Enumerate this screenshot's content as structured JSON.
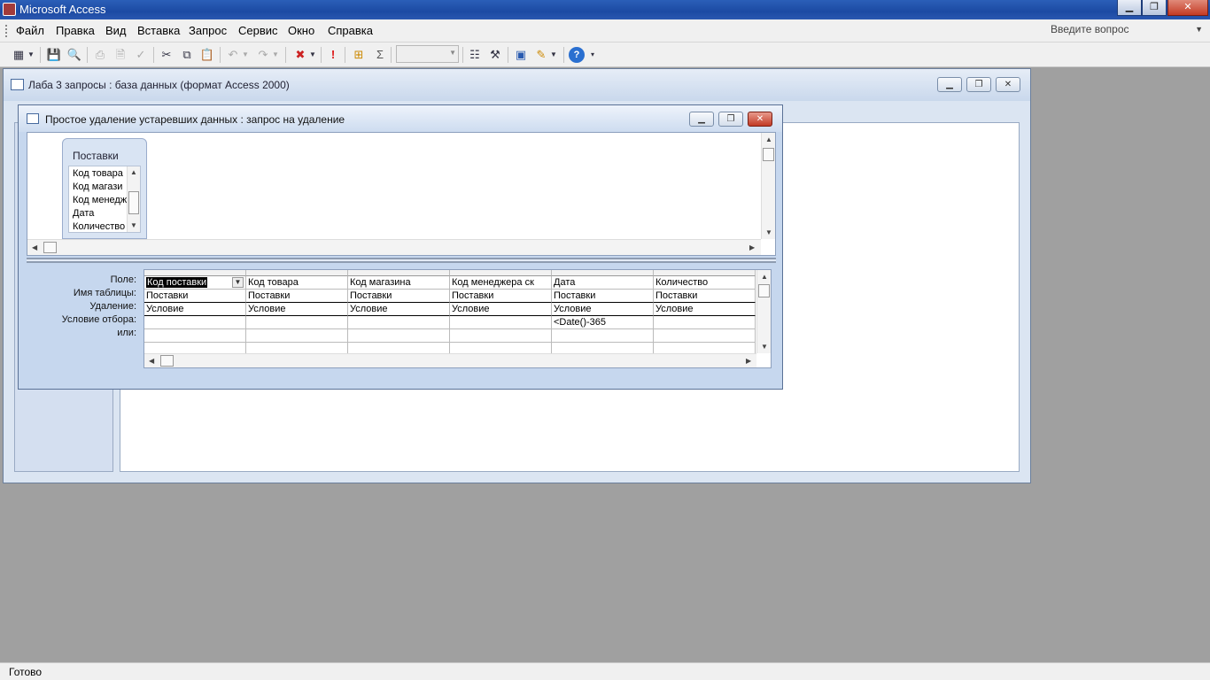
{
  "app": {
    "title": "Microsoft Access"
  },
  "menu": {
    "items": [
      "Файл",
      "Правка",
      "Вид",
      "Вставка",
      "Запрос",
      "Сервис",
      "Окно",
      "Справка"
    ],
    "help_placeholder": "Введите вопрос"
  },
  "toolbar": {
    "icons": [
      "view-icon",
      "save-icon",
      "search-icon",
      "print-icon",
      "preview-icon",
      "spell-icon",
      "cut-icon",
      "copy-icon",
      "paste-icon",
      "undo-icon",
      "redo-icon",
      "query-type-icon",
      "run-icon",
      "show-table-icon",
      "totals-icon",
      "properties-icon",
      "build-icon",
      "database-window-icon",
      "new-object-icon",
      "help-icon"
    ],
    "zoom_value": ""
  },
  "db_window": {
    "title": "Лаба 3 запросы : база данных (формат Access 2000)"
  },
  "query_window": {
    "title": "Простое удаление устаревших данных : запрос на удаление",
    "table": {
      "name": "Поставки",
      "fields": [
        "Код товара",
        "Код магази",
        "Код менедж",
        "Дата",
        "Количество"
      ]
    },
    "grid": {
      "row_labels": [
        "Поле:",
        "Имя таблицы:",
        "Удаление:",
        "Условие отбора:",
        "или:"
      ],
      "columns": [
        {
          "field": "Код поставки",
          "table": "Поставки",
          "delete": "Условие",
          "criteria": ""
        },
        {
          "field": "Код товара",
          "table": "Поставки",
          "delete": "Условие",
          "criteria": ""
        },
        {
          "field": "Код магазина",
          "table": "Поставки",
          "delete": "Условие",
          "criteria": ""
        },
        {
          "field": "Код менеджера ск",
          "table": "Поставки",
          "delete": "Условие",
          "criteria": ""
        },
        {
          "field": "Дата",
          "table": "Поставки",
          "delete": "Условие",
          "criteria": "<Date()-365"
        },
        {
          "field": "Количество",
          "table": "Поставки",
          "delete": "Условие",
          "criteria": ""
        }
      ]
    }
  },
  "status": {
    "text": "Готово"
  }
}
